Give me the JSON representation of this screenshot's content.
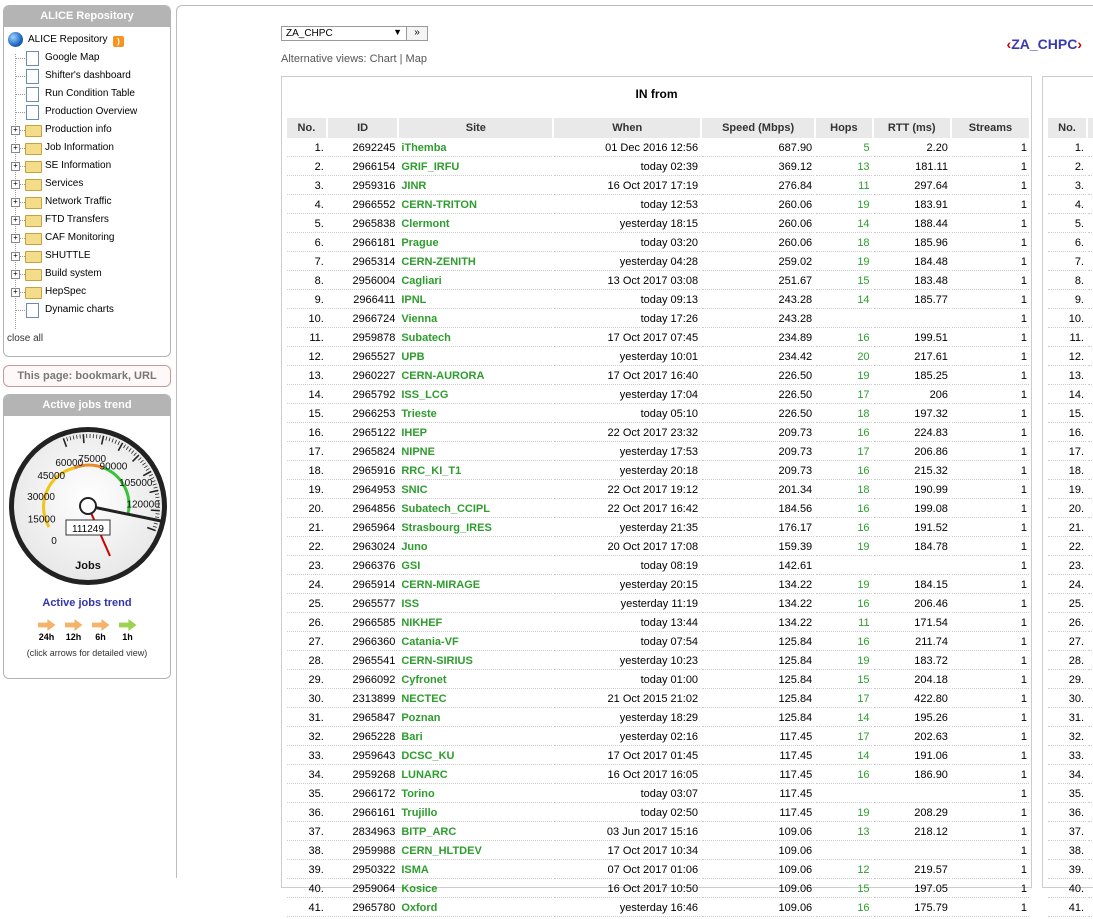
{
  "sidebar": {
    "repo_title": "ALICE Repository",
    "tree_root": "ALICE Repository",
    "tree_items": [
      {
        "label": "Google Map",
        "type": "doc"
      },
      {
        "label": "Shifter's dashboard",
        "type": "doc"
      },
      {
        "label": "Run Condition Table",
        "type": "doc"
      },
      {
        "label": "Production Overview",
        "type": "doc"
      },
      {
        "label": "Production info",
        "type": "folder"
      },
      {
        "label": "Job Information",
        "type": "folder"
      },
      {
        "label": "SE Information",
        "type": "folder"
      },
      {
        "label": "Services",
        "type": "folder"
      },
      {
        "label": "Network Traffic",
        "type": "folder"
      },
      {
        "label": "FTD Transfers",
        "type": "folder"
      },
      {
        "label": "CAF Monitoring",
        "type": "folder"
      },
      {
        "label": "SHUTTLE",
        "type": "folder"
      },
      {
        "label": "Build system",
        "type": "folder"
      },
      {
        "label": "HepSpec",
        "type": "folder"
      },
      {
        "label": "Dynamic charts",
        "type": "doc"
      }
    ],
    "close_all": "close all",
    "bookmark": "This page: bookmark, URL",
    "trend_box_title": "Active jobs trend",
    "gauge": {
      "value": "111249",
      "unit": "Jobs",
      "ticks": [
        "0",
        "15000",
        "30000",
        "45000",
        "60000",
        "75000",
        "90000",
        "105000",
        "120000"
      ]
    },
    "trend_title": "Active jobs trend",
    "arrows": [
      {
        "label": "24h",
        "color": "orange"
      },
      {
        "label": "12h",
        "color": "orange"
      },
      {
        "label": "6h",
        "color": "orange"
      },
      {
        "label": "1h",
        "color": "green"
      }
    ],
    "click_note": "(click arrows for detailed view)"
  },
  "main": {
    "site_select": "ZA_CHPC",
    "go_label": "»",
    "alt_views_prefix": "Alternative views:",
    "alt_chart": "Chart",
    "alt_sep": "|",
    "alt_map": "Map",
    "page_title": "ZA_CHPC",
    "nav_prev": "‹",
    "nav_next": "›",
    "panel_title": "IN from",
    "columns": [
      "No.",
      "ID",
      "Site",
      "When",
      "Speed (Mbps)",
      "Hops",
      "RTT (ms)",
      "Streams"
    ],
    "rows": [
      [
        "1.",
        "2692245",
        "iThemba",
        "01 Dec 2016 12:56",
        "687.90",
        "5",
        "2.20",
        "1"
      ],
      [
        "2.",
        "2966154",
        "GRIF_IRFU",
        "today 02:39",
        "369.12",
        "13",
        "181.11",
        "1"
      ],
      [
        "3.",
        "2959316",
        "JINR",
        "16 Oct 2017 17:19",
        "276.84",
        "11",
        "297.64",
        "1"
      ],
      [
        "4.",
        "2966552",
        "CERN-TRITON",
        "today 12:53",
        "260.06",
        "19",
        "183.91",
        "1"
      ],
      [
        "5.",
        "2965838",
        "Clermont",
        "yesterday 18:15",
        "260.06",
        "14",
        "188.44",
        "1"
      ],
      [
        "6.",
        "2966181",
        "Prague",
        "today 03:20",
        "260.06",
        "18",
        "185.96",
        "1"
      ],
      [
        "7.",
        "2965314",
        "CERN-ZENITH",
        "yesterday 04:28",
        "259.02",
        "19",
        "184.48",
        "1"
      ],
      [
        "8.",
        "2956004",
        "Cagliari",
        "13 Oct 2017 03:08",
        "251.67",
        "15",
        "183.48",
        "1"
      ],
      [
        "9.",
        "2966411",
        "IPNL",
        "today 09:13",
        "243.28",
        "14",
        "185.77",
        "1"
      ],
      [
        "10.",
        "2966724",
        "Vienna",
        "today 17:26",
        "243.28",
        "",
        "",
        "1"
      ],
      [
        "11.",
        "2959878",
        "Subatech",
        "17 Oct 2017 07:45",
        "234.89",
        "16",
        "199.51",
        "1"
      ],
      [
        "12.",
        "2965527",
        "UPB",
        "yesterday 10:01",
        "234.42",
        "20",
        "217.61",
        "1"
      ],
      [
        "13.",
        "2960227",
        "CERN-AURORA",
        "17 Oct 2017 16:40",
        "226.50",
        "19",
        "185.25",
        "1"
      ],
      [
        "14.",
        "2965792",
        "ISS_LCG",
        "yesterday 17:04",
        "226.50",
        "17",
        "206",
        "1"
      ],
      [
        "15.",
        "2966253",
        "Trieste",
        "today 05:10",
        "226.50",
        "18",
        "197.32",
        "1"
      ],
      [
        "16.",
        "2965122",
        "IHEP",
        "22 Oct 2017 23:32",
        "209.73",
        "16",
        "224.83",
        "1"
      ],
      [
        "17.",
        "2965824",
        "NIPNE",
        "yesterday 17:53",
        "209.73",
        "17",
        "206.86",
        "1"
      ],
      [
        "18.",
        "2965916",
        "RRC_KI_T1",
        "yesterday 20:18",
        "209.73",
        "16",
        "215.32",
        "1"
      ],
      [
        "19.",
        "2964953",
        "SNIC",
        "22 Oct 2017 19:12",
        "201.34",
        "18",
        "190.99",
        "1"
      ],
      [
        "20.",
        "2964856",
        "Subatech_CCIPL",
        "22 Oct 2017 16:42",
        "184.56",
        "16",
        "199.08",
        "1"
      ],
      [
        "21.",
        "2965964",
        "Strasbourg_IRES",
        "yesterday 21:35",
        "176.17",
        "16",
        "191.52",
        "1"
      ],
      [
        "22.",
        "2963024",
        "Juno",
        "20 Oct 2017 17:08",
        "159.39",
        "19",
        "184.78",
        "1"
      ],
      [
        "23.",
        "2966376",
        "GSI",
        "today 08:19",
        "142.61",
        "",
        "",
        "1"
      ],
      [
        "24.",
        "2965914",
        "CERN-MIRAGE",
        "yesterday 20:15",
        "134.22",
        "19",
        "184.15",
        "1"
      ],
      [
        "25.",
        "2965577",
        "ISS",
        "yesterday 11:19",
        "134.22",
        "16",
        "206.46",
        "1"
      ],
      [
        "26.",
        "2966585",
        "NIKHEF",
        "today 13:44",
        "134.22",
        "11",
        "171.54",
        "1"
      ],
      [
        "27.",
        "2966360",
        "Catania-VF",
        "today 07:54",
        "125.84",
        "16",
        "211.74",
        "1"
      ],
      [
        "28.",
        "2965541",
        "CERN-SIRIUS",
        "yesterday 10:23",
        "125.84",
        "19",
        "183.72",
        "1"
      ],
      [
        "29.",
        "2966092",
        "Cyfronet",
        "today 01:00",
        "125.84",
        "15",
        "204.18",
        "1"
      ],
      [
        "30.",
        "2313899",
        "NECTEC",
        "21 Oct 2015 21:02",
        "125.84",
        "17",
        "422.80",
        "1"
      ],
      [
        "31.",
        "2965847",
        "Poznan",
        "yesterday 18:29",
        "125.84",
        "14",
        "195.26",
        "1"
      ],
      [
        "32.",
        "2965228",
        "Bari",
        "yesterday 02:16",
        "117.45",
        "17",
        "202.63",
        "1"
      ],
      [
        "33.",
        "2959643",
        "DCSC_KU",
        "17 Oct 2017 01:45",
        "117.45",
        "14",
        "191.06",
        "1"
      ],
      [
        "34.",
        "2959268",
        "LUNARC",
        "16 Oct 2017 16:05",
        "117.45",
        "16",
        "186.90",
        "1"
      ],
      [
        "35.",
        "2966172",
        "Torino",
        "today 03:07",
        "117.45",
        "",
        "",
        "1"
      ],
      [
        "36.",
        "2966161",
        "Trujillo",
        "today 02:50",
        "117.45",
        "19",
        "208.29",
        "1"
      ],
      [
        "37.",
        "2834963",
        "BITP_ARC",
        "03 Jun 2017 15:16",
        "109.06",
        "13",
        "218.12",
        "1"
      ],
      [
        "38.",
        "2959988",
        "CERN_HLTDEV",
        "17 Oct 2017 10:34",
        "109.06",
        "",
        "",
        "1"
      ],
      [
        "39.",
        "2950322",
        "ISMA",
        "07 Oct 2017 01:06",
        "109.06",
        "12",
        "219.57",
        "1"
      ],
      [
        "40.",
        "2959064",
        "Kosice",
        "16 Oct 2017 10:50",
        "109.06",
        "15",
        "197.05",
        "1"
      ],
      [
        "41.",
        "2965780",
        "Oxford",
        "yesterday 16:46",
        "109.06",
        "16",
        "175.79",
        "1"
      ]
    ],
    "panel2_column": "No.",
    "panel2_rows": [
      "1.",
      "2.",
      "3.",
      "4.",
      "5.",
      "6.",
      "7.",
      "8.",
      "9.",
      "10.",
      "11.",
      "12.",
      "13.",
      "14.",
      "15.",
      "16.",
      "17.",
      "18.",
      "19.",
      "20.",
      "21.",
      "22.",
      "23.",
      "24.",
      "25.",
      "26.",
      "27.",
      "28.",
      "29.",
      "30.",
      "31.",
      "32.",
      "33.",
      "34.",
      "35.",
      "36.",
      "37.",
      "38.",
      "39.",
      "40.",
      "41."
    ]
  }
}
